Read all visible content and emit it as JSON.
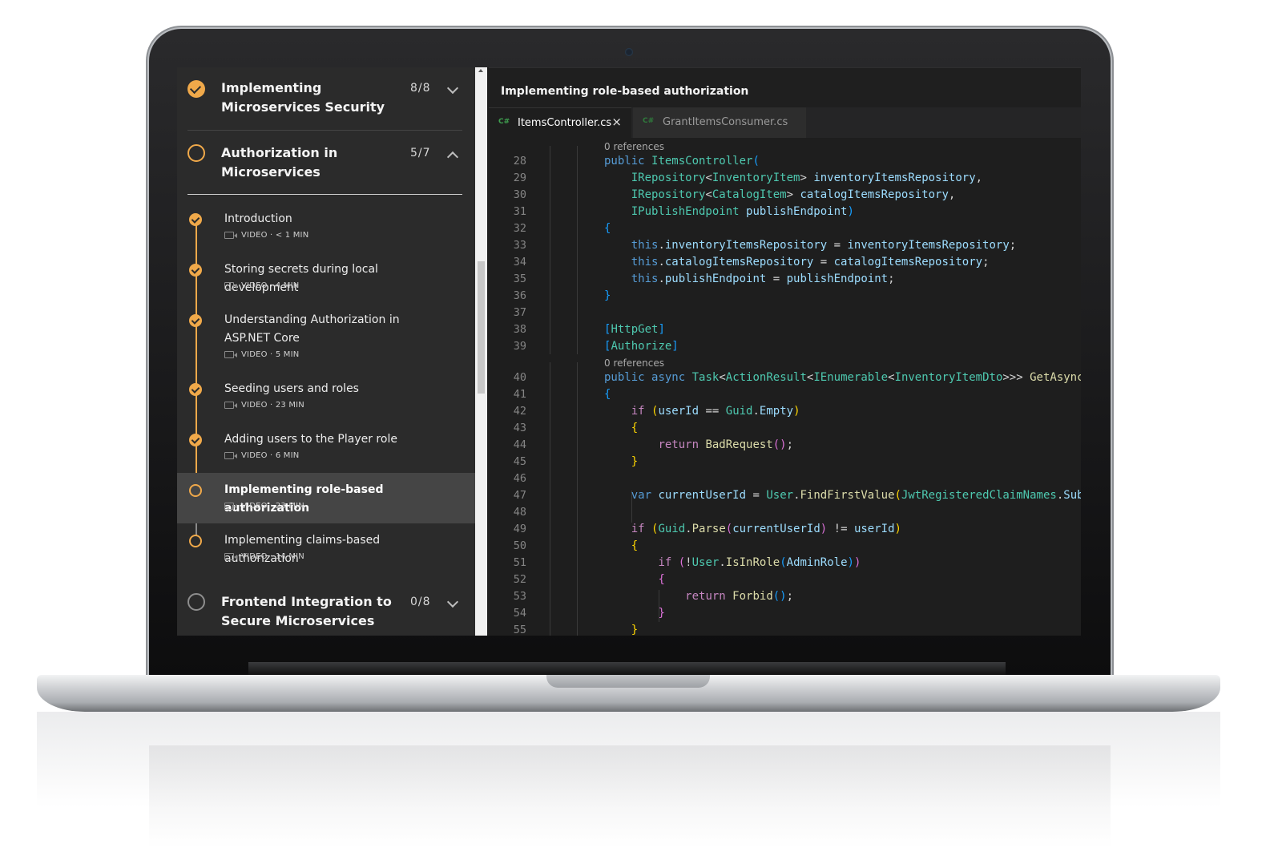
{
  "sidebar": {
    "modules": [
      {
        "title": "Implementing Microservices Security",
        "count": "8/8",
        "status": "complete",
        "expanded": false
      },
      {
        "title": "Authorization in Microservices",
        "count": "5/7",
        "status": "in-progress",
        "expanded": true
      },
      {
        "title": "Frontend Integration to Secure Microservices",
        "count": "0/8",
        "status": "not-started",
        "expanded": false
      }
    ],
    "clips": [
      {
        "title": "Introduction",
        "meta": "VIDEO · < 1 MIN",
        "done": true
      },
      {
        "title": "Storing secrets during local development",
        "meta": "VIDEO · 4 MIN",
        "done": true
      },
      {
        "title": "Understanding Authorization in ASP.NET Core",
        "meta": "VIDEO · 5 MIN",
        "done": true
      },
      {
        "title": "Seeding users and roles",
        "meta": "VIDEO · 23 MIN",
        "done": true
      },
      {
        "title": "Adding users to the Player role",
        "meta": "VIDEO · 6 MIN",
        "done": true
      },
      {
        "title": "Implementing role-based authorization",
        "meta": "VIDEO · 23 MIN",
        "done": false,
        "active": true
      },
      {
        "title": "Implementing claims-based authorization",
        "meta": "VIDEO · 14 MIN",
        "done": false
      }
    ]
  },
  "editor": {
    "title": "Implementing role-based authorization",
    "tabs": [
      {
        "lang": "C#",
        "label": "ItemsController.cs",
        "active": true,
        "close": "×"
      },
      {
        "lang": "C#",
        "label": "GrantItemsConsumer.cs",
        "active": false
      }
    ],
    "codelens": [
      "0 references",
      "0 references"
    ],
    "line_numbers": [
      "28",
      "29",
      "30",
      "31",
      "32",
      "33",
      "34",
      "35",
      "36",
      "37",
      "38",
      "39",
      "40",
      "41",
      "42",
      "43",
      "44",
      "45",
      "46",
      "47",
      "48",
      "49",
      "50",
      "51",
      "52",
      "53",
      "54",
      "55"
    ]
  },
  "colors": {
    "accent": "#f0a94a",
    "sidebar_bg": "#2b2b2b",
    "editor_bg": "#1e1e1e"
  }
}
